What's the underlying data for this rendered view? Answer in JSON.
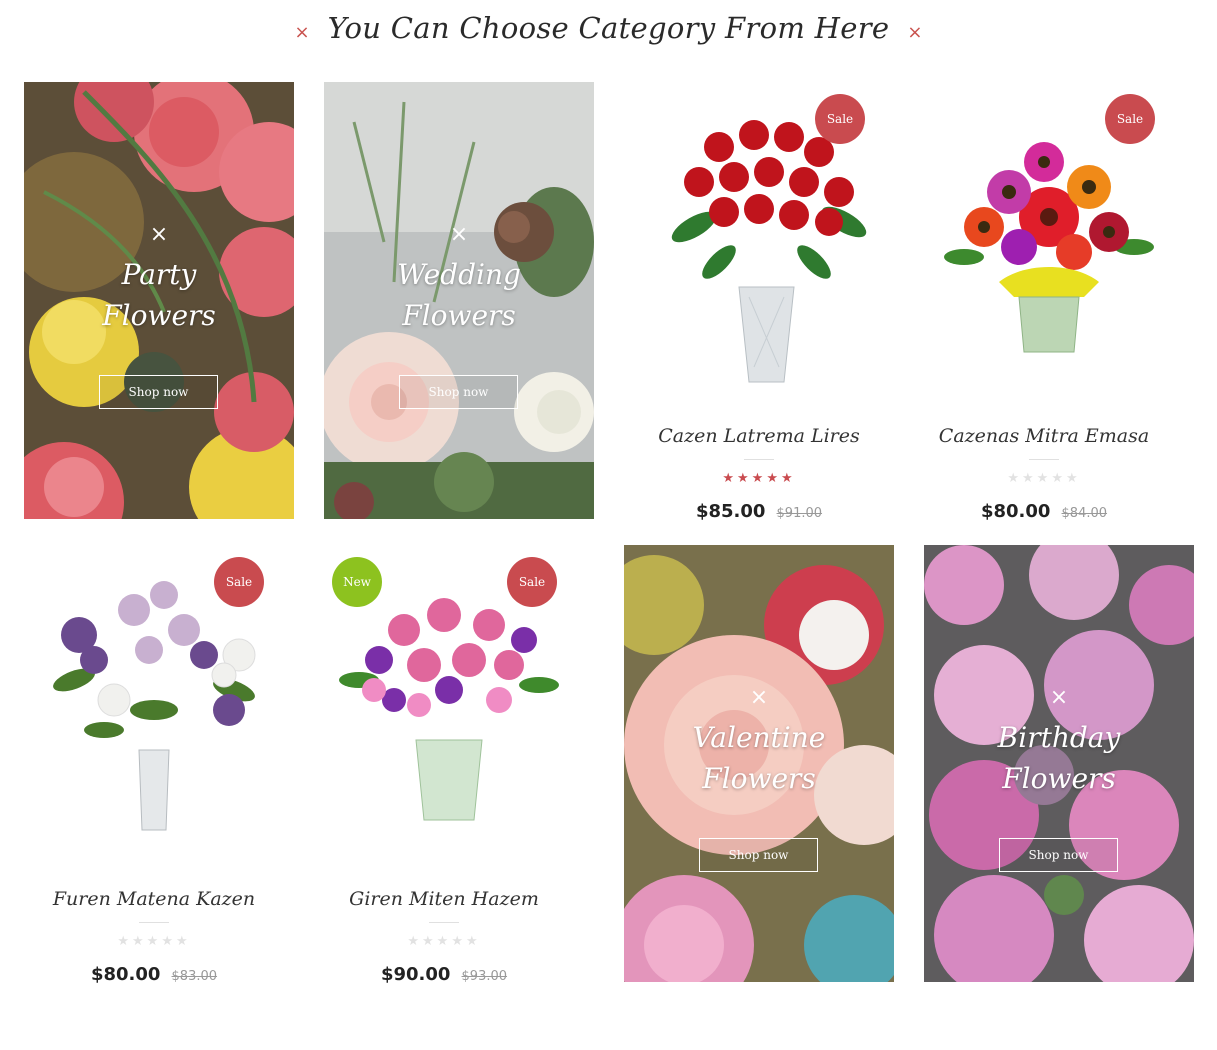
{
  "section": {
    "title": "You Can Choose Category From Here",
    "left_mark": "×",
    "right_mark": "×"
  },
  "categories": [
    {
      "line1": "Party",
      "line2": "Flowers",
      "button": "Shop now",
      "close": "×"
    },
    {
      "line1": "Wedding",
      "line2": "Flowers",
      "button": "Shop now",
      "close": "×"
    },
    {
      "line1": "Valentine",
      "line2": "Flowers",
      "button": "Shop now",
      "close": "×"
    },
    {
      "line1": "Birthday",
      "line2": "Flowers",
      "button": "Shop now",
      "close": "×"
    }
  ],
  "products": [
    {
      "name": "Cazen Latrema Lires",
      "price": "$85.00",
      "old_price": "$91.00",
      "rating": 4.5,
      "badges": [
        "Sale"
      ]
    },
    {
      "name": "Cazenas Mitra Emasa",
      "price": "$80.00",
      "old_price": "$84.00",
      "rating": 0,
      "badges": [
        "Sale"
      ]
    },
    {
      "name": "Furen Matena Kazen",
      "price": "$80.00",
      "old_price": "$83.00",
      "rating": 0,
      "badges": [
        "Sale"
      ]
    },
    {
      "name": "Giren Miten Hazem",
      "price": "$90.00",
      "old_price": "$93.00",
      "rating": 0,
      "badges": [
        "New",
        "Sale"
      ]
    }
  ],
  "colors": {
    "sale_badge": "#c94b4f",
    "new_badge": "#8dc21f",
    "star_active": "#c94b4f",
    "star_inactive": "#e2e2e2"
  },
  "icons": {
    "star": "★"
  }
}
